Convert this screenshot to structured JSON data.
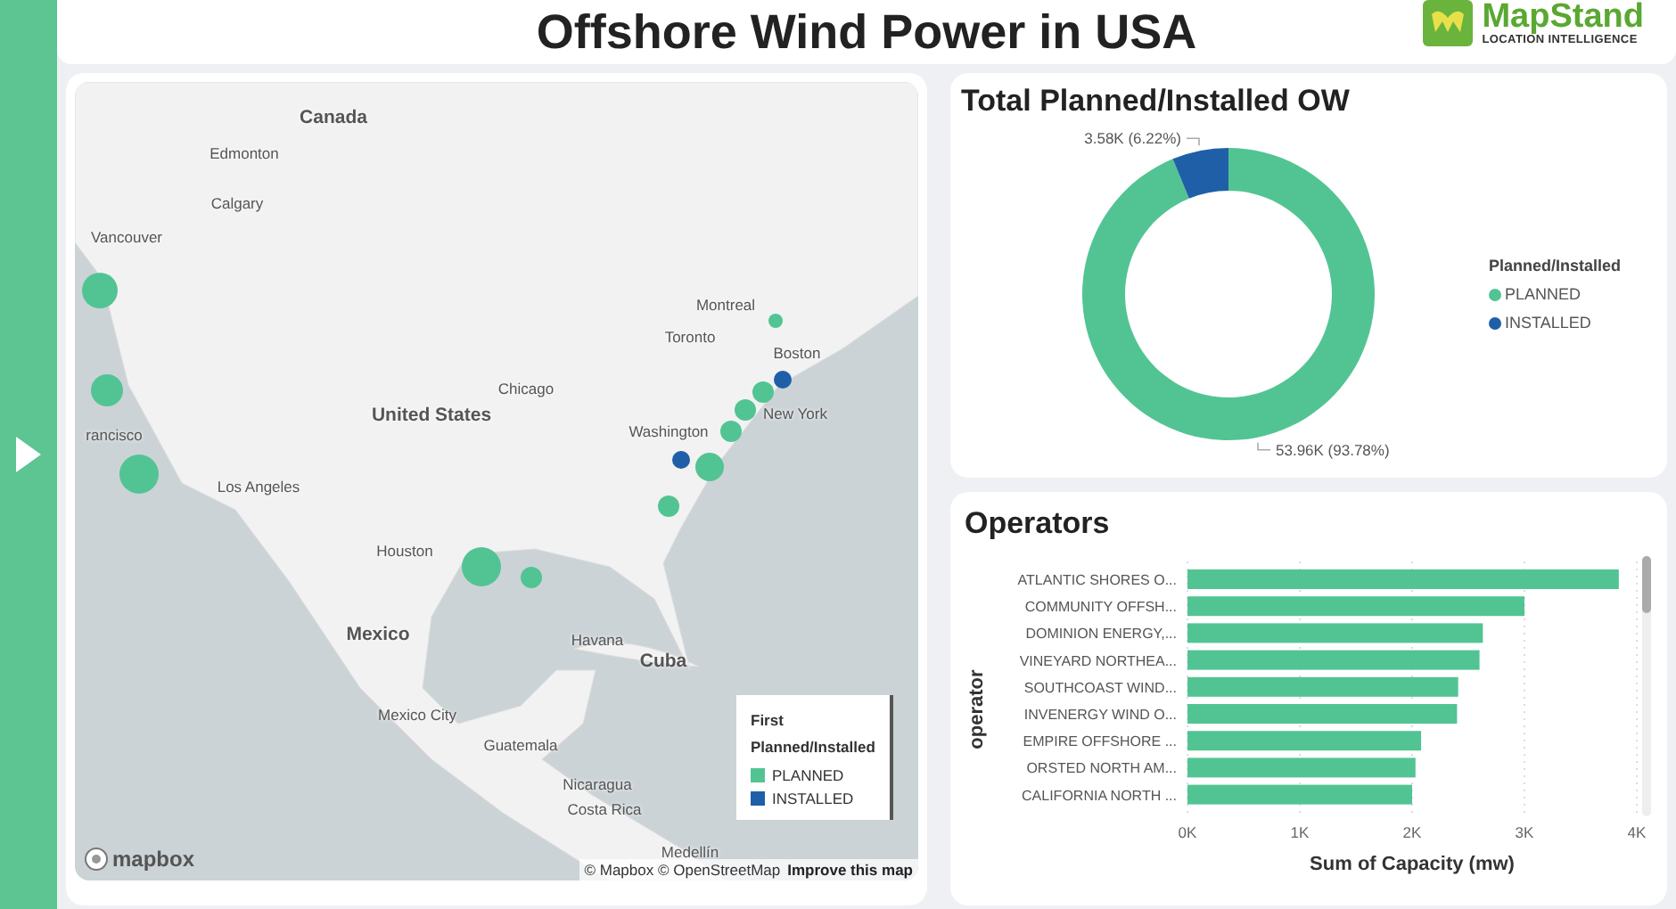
{
  "header": {
    "title": "Offshore Wind Power in USA",
    "logo": {
      "name": "MapStand",
      "tagline": "LOCATION INTELLIGENCE"
    }
  },
  "map": {
    "labels": [
      {
        "text": "Canada",
        "kind": "country"
      },
      {
        "text": "Edmonton",
        "kind": "city"
      },
      {
        "text": "Calgary",
        "kind": "city"
      },
      {
        "text": "Vancouver",
        "kind": "city"
      },
      {
        "text": "Montreal",
        "kind": "city"
      },
      {
        "text": "Toronto",
        "kind": "city"
      },
      {
        "text": "Boston",
        "kind": "city"
      },
      {
        "text": "Chicago",
        "kind": "city"
      },
      {
        "text": "United States",
        "kind": "country"
      },
      {
        "text": "New York",
        "kind": "city"
      },
      {
        "text": "Washington",
        "kind": "city"
      },
      {
        "text": "rancisco",
        "kind": "city"
      },
      {
        "text": "Los Angeles",
        "kind": "city"
      },
      {
        "text": "Houston",
        "kind": "city"
      },
      {
        "text": "Mexico",
        "kind": "country"
      },
      {
        "text": "Havana",
        "kind": "city"
      },
      {
        "text": "Cuba",
        "kind": "country"
      },
      {
        "text": "Mexico City",
        "kind": "city"
      },
      {
        "text": "Guatemala",
        "kind": "city"
      },
      {
        "text": "Nicaragua",
        "kind": "city"
      },
      {
        "text": "Costa Rica",
        "kind": "city"
      },
      {
        "text": "Medellín",
        "kind": "city"
      }
    ],
    "markers": [
      {
        "color": "#52c493"
      },
      {
        "color": "#52c493"
      },
      {
        "color": "#52c493"
      },
      {
        "color": "#52c493"
      },
      {
        "color": "#52c493"
      },
      {
        "color": "#52c493"
      },
      {
        "color": "#52c493"
      },
      {
        "color": "#52c493"
      },
      {
        "color": "#52c493"
      },
      {
        "color": "#52c493"
      },
      {
        "color": "#1f5fa8"
      },
      {
        "color": "#1f5fa8"
      },
      {
        "color": "#52c493"
      }
    ],
    "legend": {
      "title": "First Planned/Installed",
      "items": [
        {
          "label": "PLANNED",
          "color": "#52c493"
        },
        {
          "label": "INSTALLED",
          "color": "#1f5fa8"
        }
      ]
    },
    "attribution": {
      "logo": "mapbox",
      "copyright": "© Mapbox © OpenStreetMap",
      "link": "Improve this map"
    }
  },
  "donut_card": {
    "title": "Total Planned/Installed OW",
    "chart_data": {
      "type": "donut",
      "values": [
        93.78,
        6.22
      ],
      "value_labels": [
        "53.96K (93.78%)",
        "3.58K (6.22%)"
      ]
    },
    "legend": {
      "title": "Planned/Installed",
      "items": [
        {
          "label": "PLANNED",
          "color": "#52c493"
        },
        {
          "label": "INSTALLED",
          "color": "#1f5fa8"
        }
      ]
    }
  },
  "operators_card": {
    "title": "Operators",
    "chart_data": {
      "type": "bar",
      "orientation": "horizontal",
      "xlabel": "Sum of Capacity (mw)",
      "ylabel": "operator",
      "categories": [
        "ATLANTIC SHORES O...",
        "COMMUNITY OFFSH...",
        "DOMINION ENERGY,...",
        "VINEYARD NORTHEA...",
        "SOUTHCOAST WIND...",
        "INVENERGY WIND O...",
        "EMPIRE OFFSHORE ...",
        "ORSTED NORTH AM...",
        "CALIFORNIA NORTH ..."
      ],
      "series": [
        {
          "color": "#52c493",
          "values": [
            3840,
            3000,
            2630,
            2600,
            2410,
            2400,
            2080,
            2030,
            2000
          ]
        }
      ],
      "grid": true,
      "xlim": [
        0,
        4000
      ],
      "xticks": [
        {
          "value": 0,
          "label": "0K"
        },
        {
          "value": 1000,
          "label": "1K"
        },
        {
          "value": 2000,
          "label": "2K"
        },
        {
          "value": 3000,
          "label": "3K"
        },
        {
          "value": 4000,
          "label": "4K"
        }
      ]
    }
  }
}
